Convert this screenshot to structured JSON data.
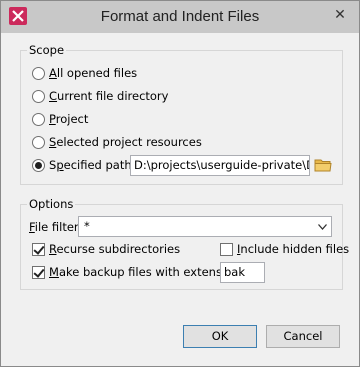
{
  "window": {
    "title": "Format and Indent Files",
    "close_glyph": "✕"
  },
  "scope": {
    "label": "Scope",
    "options": [
      {
        "pre": "",
        "u": "A",
        "post": "ll opened files",
        "checked": false
      },
      {
        "pre": "",
        "u": "C",
        "post": "urrent file directory",
        "checked": false
      },
      {
        "pre": "",
        "u": "P",
        "post": "roject",
        "checked": false
      },
      {
        "pre": "",
        "u": "S",
        "post": "elected project resources",
        "checked": false
      },
      {
        "pre": "S",
        "u": "p",
        "post": "ecified path:",
        "checked": true
      }
    ],
    "path_value": "D:\\projects\\userguide-private\\DITA"
  },
  "options": {
    "label": "Options",
    "file_filter": {
      "u": "F",
      "post": "ile filter:",
      "value": "*"
    },
    "recurse": {
      "u": "R",
      "post": "ecurse subdirectories",
      "checked": true
    },
    "hidden": {
      "u": "I",
      "post": "nclude hidden files",
      "checked": false
    },
    "backup": {
      "u": "M",
      "post": "ake backup files with extension:",
      "checked": true,
      "value": "bak"
    }
  },
  "buttons": {
    "ok": "OK",
    "cancel": "Cancel"
  },
  "icons": {
    "app": "oxygen-app-icon",
    "folder": "folder-icon",
    "dropdown": "chevron-down-icon"
  },
  "colors": {
    "accent": "#3c7fb1",
    "app_icon": "#cc2a5c",
    "folder": "#e8b84a"
  }
}
